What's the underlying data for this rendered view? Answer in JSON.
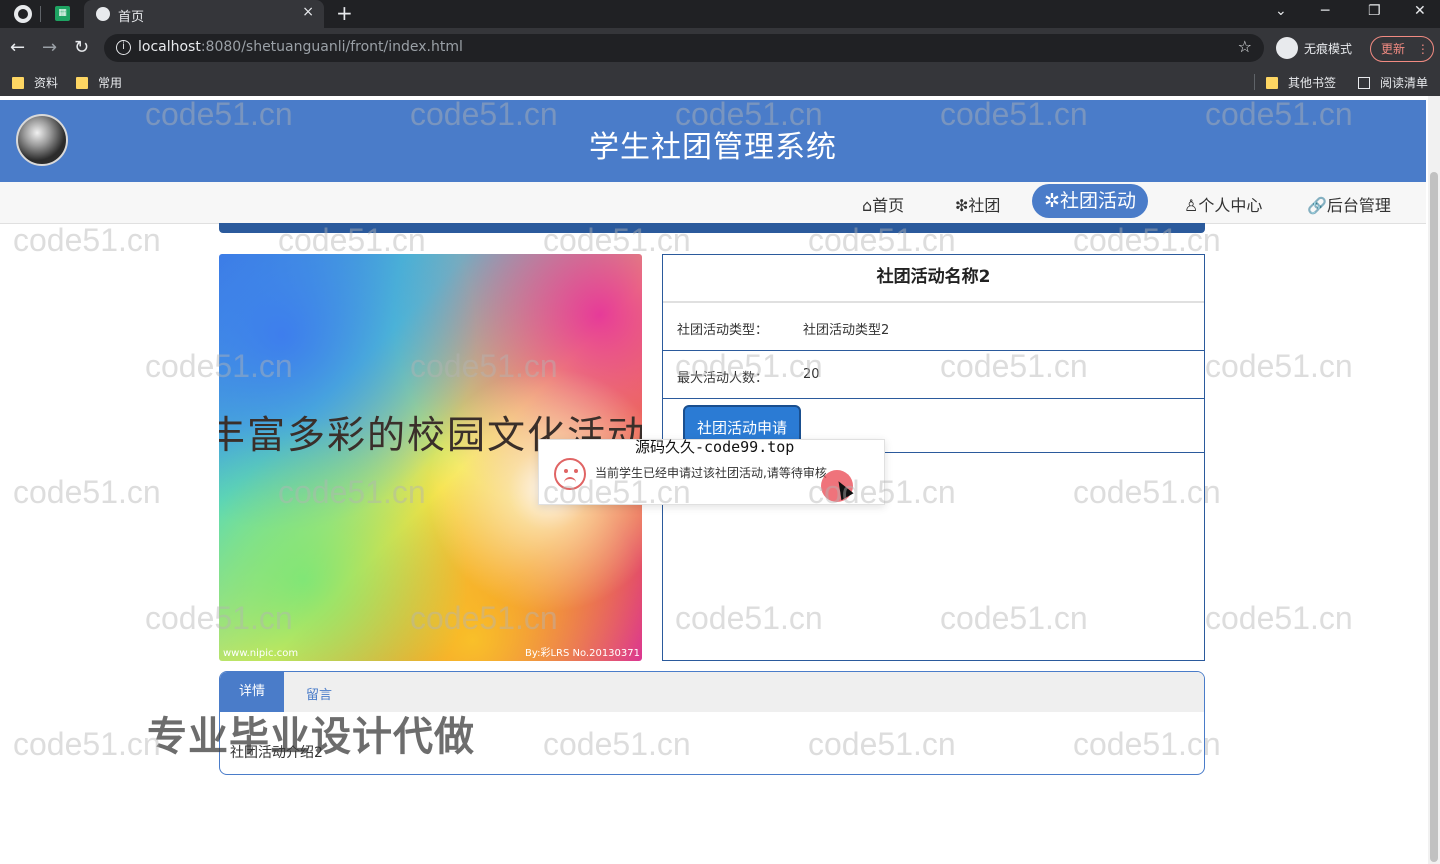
{
  "browser": {
    "tab_title": "首页",
    "tab_close": "×",
    "new_tab": "+",
    "url_host": "localhost",
    "url_path": ":8080/shetuanguanli/front/index.html",
    "profile_label": "无痕模式",
    "update_label": "更新",
    "update_menu": "⋮",
    "win_min": "─",
    "win_max": "❐",
    "win_close": "✕",
    "win_tabs": "⌄",
    "bookmarks": [
      "资料",
      "常用"
    ],
    "bookmarks_right": [
      "其他书签",
      "阅读清单"
    ]
  },
  "site": {
    "title": "学生社团管理系统"
  },
  "nav": {
    "items": [
      "⌂首页",
      "❇社团",
      "✲社团活动",
      "♙个人中心",
      "🔗后台管理"
    ],
    "active_index": 2
  },
  "banner": {
    "text": "丰富多彩的校园文化活动",
    "foot_left": "www.nipic.com",
    "foot_right": "By:彩LRS No.20130371"
  },
  "activity": {
    "name": "社团活动名称2",
    "type_label": "社团活动类型：",
    "type_value": "社团活动类型2",
    "max_label": "最大活动人数：",
    "max_value": "20",
    "apply_button": "社团活动申请"
  },
  "tabs": {
    "detail": "详情",
    "message": "留言",
    "content": "社团活动介绍2"
  },
  "toast": {
    "title": "源码久久-code99.top",
    "message": "当前学生已经申请过该社团活动,请等待审核"
  },
  "overlay": {
    "text": "专业毕业设计代做"
  },
  "watermark": "code51.cn",
  "colors": {
    "header": "#4a7cc9",
    "strip": "#2b5a9c",
    "apply": "#2b7bd4",
    "error": "#e06464"
  }
}
